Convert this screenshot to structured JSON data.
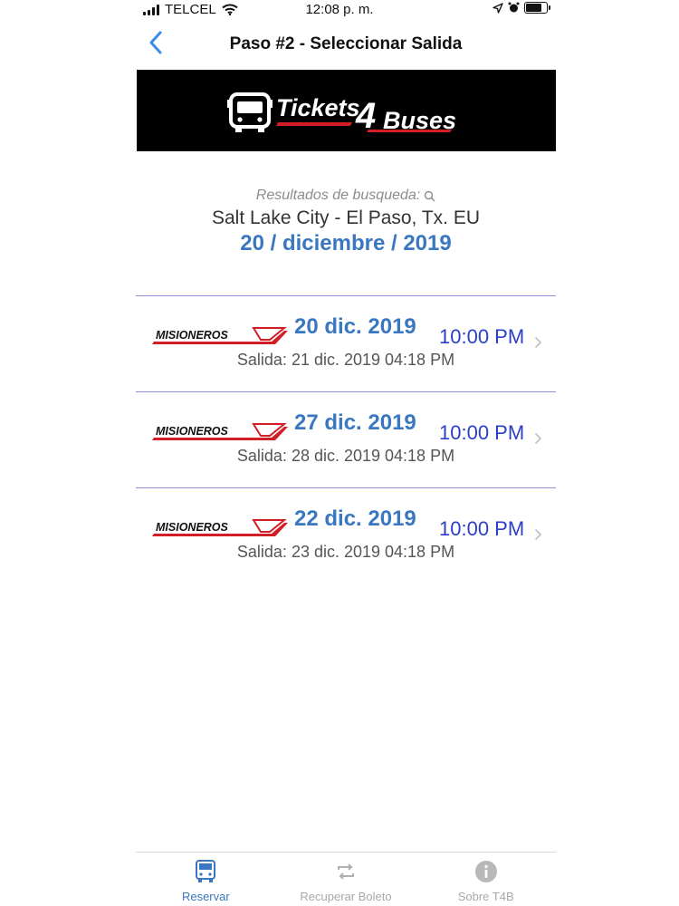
{
  "status_bar": {
    "carrier": "TELCEL",
    "time": "12:08 p. m.",
    "battery_level": 0.8
  },
  "nav": {
    "title": "Paso #2 - Seleccionar Salida",
    "back_icon": "chevron-left-icon"
  },
  "banner": {
    "logo_text_a": "Tickets",
    "logo_text_b": "4",
    "logo_text_c": "Buses"
  },
  "search": {
    "label": "Resultados de busqueda:",
    "route": "Salt Lake City - El Paso, Tx. EU",
    "date": "20 / diciembre / 2019"
  },
  "results": [
    {
      "carrier": "MISIONEROS",
      "date": "20 dic. 2019",
      "time": "10:00 PM",
      "departure": "Salida: 21 dic. 2019 04:18 PM"
    },
    {
      "carrier": "MISIONEROS",
      "date": "27 dic. 2019",
      "time": "10:00 PM",
      "departure": "Salida: 28 dic. 2019 04:18 PM"
    },
    {
      "carrier": "MISIONEROS",
      "date": "22 dic. 2019",
      "time": "10:00 PM",
      "departure": "Salida: 23 dic. 2019 04:18 PM"
    }
  ],
  "tabs": [
    {
      "label": "Reservar",
      "icon": "bus-icon",
      "active": true
    },
    {
      "label": "Recuperar Boleto",
      "icon": "refresh-icon",
      "active": false
    },
    {
      "label": "Sobre T4B",
      "icon": "info-icon",
      "active": false
    }
  ],
  "colors": {
    "accent": "#3a77c1",
    "time": "#2a3fc7",
    "divider": "#8f8fd8",
    "logo_red": "#d21f26"
  }
}
